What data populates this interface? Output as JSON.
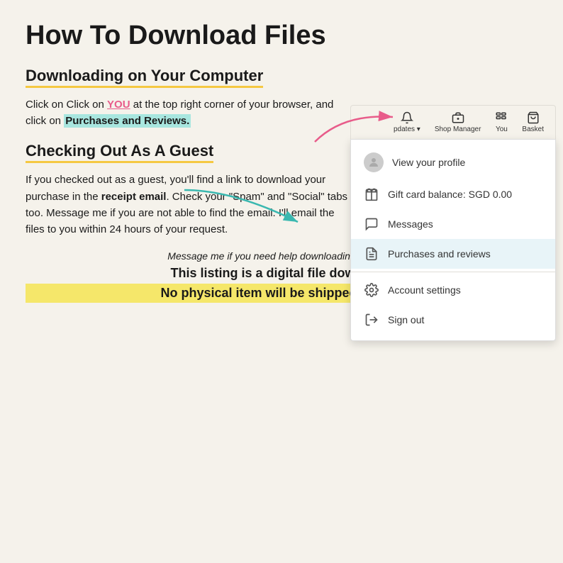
{
  "page": {
    "title": "How To Download Files",
    "section1": {
      "heading": "Downloading on Your Computer",
      "body_part1": "Click on Click on ",
      "body_highlight_you": "YOU",
      "body_part2": " at the top right corner of your browser, and click on ",
      "body_highlight_purchases": "Purchases and Reviews.",
      "body_end": ""
    },
    "section2": {
      "heading": "Checking Out As A Guest",
      "body": "If you checked out as a guest, you'll find a link to download your purchase in the receipt email. Check your \"Spam\" and \"Social\" tabs too. Message me if you are not able to find the email. I'll email the files to you within 24 hours of your request."
    },
    "footer": {
      "italic_msg": "Message me if you need help downloading the files!",
      "line1": "This listing is a digital file download.",
      "line2": "No physical item will be shipped to you."
    }
  },
  "navbar": {
    "updates_label": "pdates",
    "shop_manager_label": "Shop Manager",
    "you_label": "You",
    "basket_label": "Basket"
  },
  "dropdown": {
    "view_profile": "View your profile",
    "gift_card": "Gift card balance: SGD 0.00",
    "messages": "Messages",
    "purchases_reviews": "Purchases and reviews",
    "account_settings": "Account settings",
    "sign_out": "Sign out"
  }
}
